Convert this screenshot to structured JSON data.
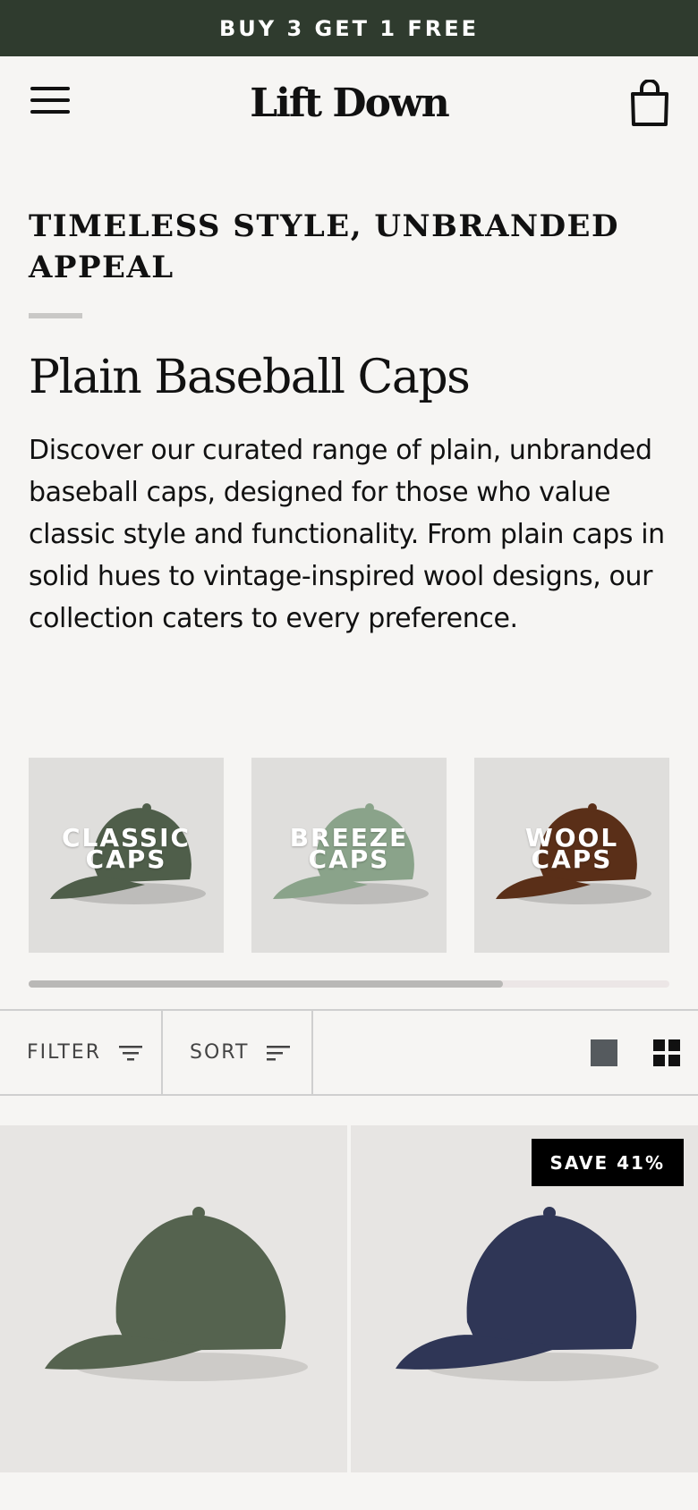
{
  "announcement": {
    "text": "BUY 3 GET 1 FREE"
  },
  "header": {
    "logo": "Lift Down",
    "menu_icon": "hamburger-menu-icon",
    "cart_icon": "shopping-bag-icon"
  },
  "intro": {
    "eyebrow": "TIMELESS STYLE, UNBRANDED APPEAL",
    "title": "Plain Baseball Caps",
    "description": "Discover our curated range of plain, unbranded baseball caps, designed for those who value classic style and functionality. From plain caps in solid hues to vintage-inspired wool designs, our collection caters to every preference."
  },
  "collections": [
    {
      "label": "CLASSIC\nCAPS",
      "cap_color": "#4f5e4a"
    },
    {
      "label": "BREEZE\nCAPS",
      "cap_color": "#8aa38a"
    },
    {
      "label": "WOOL\nCAPS",
      "cap_color": "#5a2f18"
    }
  ],
  "collections_scroll": {
    "progress": 0.74
  },
  "toolbar": {
    "filter_label": "FILTER",
    "sort_label": "SORT"
  },
  "products": [
    {
      "cap_color": "#55634f",
      "badge": ""
    },
    {
      "cap_color": "#2f3656",
      "badge": "SAVE 41%"
    }
  ]
}
